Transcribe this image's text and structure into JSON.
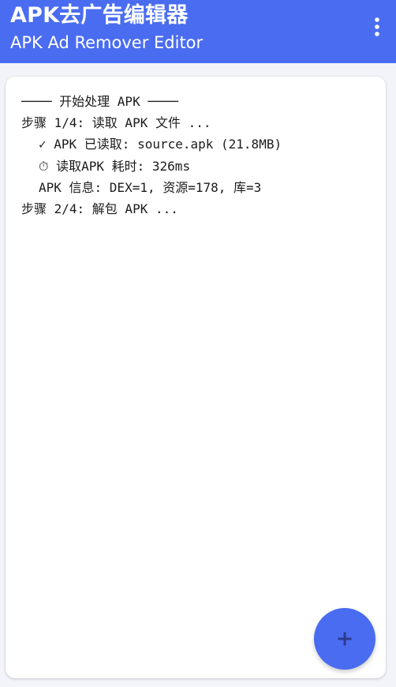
{
  "app_bar": {
    "title": "APK去广告编辑器",
    "subtitle": "APK Ad Remover Editor",
    "menu_icon": "more-vert-icon"
  },
  "log": {
    "lines": [
      "──── 开始处理 APK ────",
      "步骤 1/4: 读取 APK 文件 ...",
      "✓ APK 已读取: source.apk (21.8MB)",
      "⏱ 读取APK 耗时: 326ms",
      "APK 信息: DEX=1, 资源=178, 库=3",
      "步骤 2/4: 解包 APK ..."
    ]
  },
  "fab": {
    "icon": "add-icon"
  },
  "colors": {
    "primary": "#4a6cf0",
    "background": "#f3f4fa",
    "card": "#ffffff",
    "text": "#1b1b1b",
    "fab_icon": "#2d3a8c"
  }
}
